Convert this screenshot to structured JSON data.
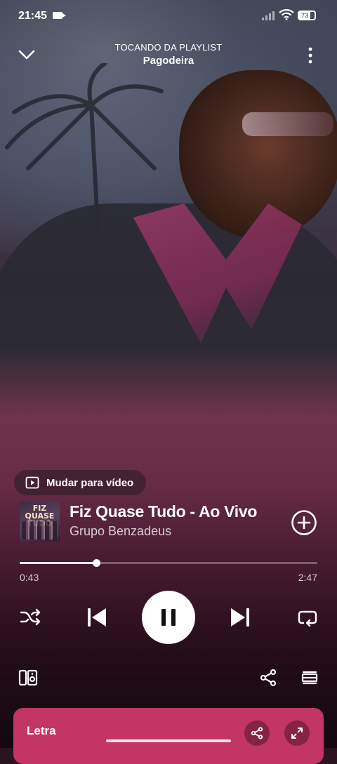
{
  "status_bar": {
    "time": "21:45",
    "battery": "73"
  },
  "header": {
    "subtitle": "TOCANDO DA PLAYLIST",
    "playlist": "Pagodeira"
  },
  "video_toggle": {
    "label": "Mudar para vídeo"
  },
  "track": {
    "title": "Fiz Quase Tudo - Ao Vivo",
    "artist": "Grupo Benzadeus",
    "cover_text": "FIZ QUASE TUDO",
    "elapsed": "0:43",
    "duration": "2:47",
    "progress_fraction": 0.258
  },
  "lyrics": {
    "label": "Letra"
  },
  "colors": {
    "accent": "#c23565",
    "background": "#2a1420"
  },
  "icons": [
    "chevron-down-icon",
    "more-vertical-icon",
    "play-video-icon",
    "add-circle-icon",
    "shuffle-icon",
    "previous-icon",
    "pause-icon",
    "next-icon",
    "repeat-icon",
    "devices-icon",
    "share-icon",
    "queue-icon",
    "expand-icon"
  ]
}
